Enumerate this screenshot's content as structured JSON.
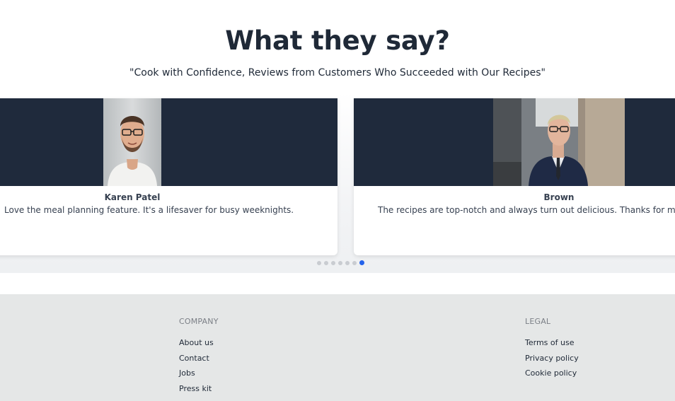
{
  "section": {
    "title": "What they say?",
    "subtitle": "\"Cook with Confidence, Reviews from Customers Who Succeeded with Our Recipes\""
  },
  "testimonials": [
    {
      "name": "Karen Patel",
      "quote": "Love the meal planning feature. It's a lifesaver for busy weeknights."
    },
    {
      "name": "Brown",
      "quote": "The recipes are top-notch and always turn out delicious. Thanks for making m"
    }
  ],
  "carousel": {
    "dot_count": 7,
    "active_index": 6,
    "active_color": "#2563eb"
  },
  "footer": {
    "company": {
      "title": "COMPANY",
      "links": [
        "About us",
        "Contact",
        "Jobs",
        "Press kit"
      ]
    },
    "legal": {
      "title": "LEGAL",
      "links": [
        "Terms of use",
        "Privacy policy",
        "Cookie policy"
      ]
    }
  },
  "colors": {
    "heading": "#1f2937",
    "card_banner": "#1f2a3c",
    "footer_bg": "#e5e7e7"
  }
}
